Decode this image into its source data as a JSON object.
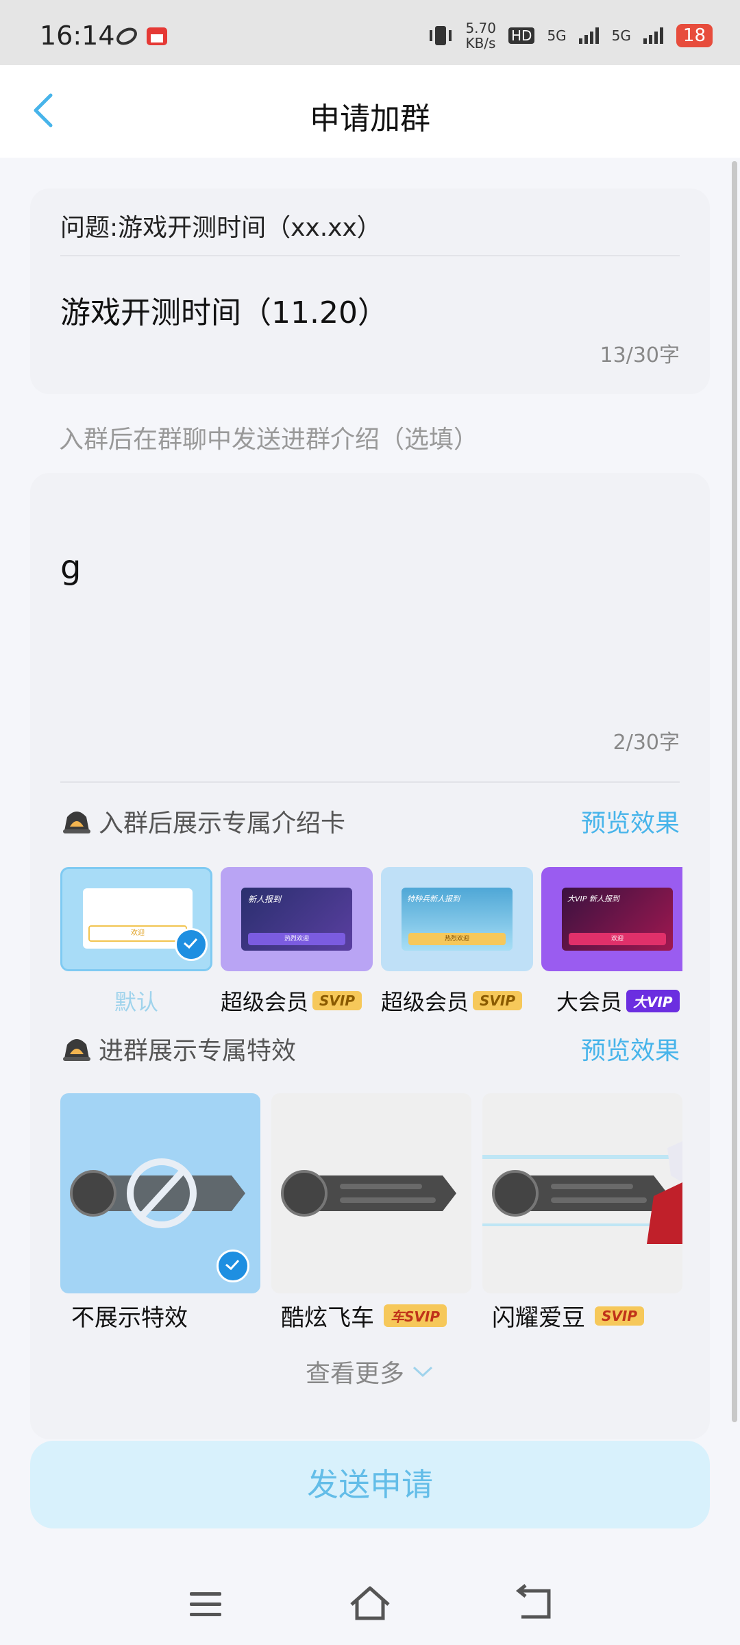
{
  "status_bar": {
    "time": "16:14",
    "net_speed_value": "5.70",
    "net_speed_unit": "KB/s",
    "hd": "HD",
    "sim1": "5G",
    "sim2": "5G",
    "battery": "18"
  },
  "header": {
    "title": "申请加群"
  },
  "question": {
    "prompt": "问题:游戏开测时间（xx.xx）",
    "answer": "游戏开测时间（11.20）",
    "count": "13/30字"
  },
  "intro": {
    "label": "入群后在群聊中发送进群介绍（选填）",
    "value": "g",
    "count": "2/30字"
  },
  "intro_card_section": {
    "title": "入群后展示专属介绍卡",
    "preview": "预览效果",
    "cards": [
      {
        "label": "默认",
        "tag": "",
        "selected": true
      },
      {
        "label": "超级会员",
        "tag": "SVIP",
        "selected": false
      },
      {
        "label": "超级会员",
        "tag": "SVIP",
        "selected": false
      },
      {
        "label": "大会员",
        "tag": "大VIP",
        "selected": false
      }
    ],
    "card_texts": {
      "c1_button": "欢迎",
      "c2_title": "新人报到",
      "c2_button": "热烈欢迎",
      "c3_title": "特种兵新人报到",
      "c3_button": "热烈欢迎",
      "c4_title": "大VIP 新人报到",
      "c4_button": "欢迎"
    }
  },
  "effect_section": {
    "title": "进群展示专属特效",
    "preview": "预览效果",
    "effects": [
      {
        "label": "不展示特效",
        "tag": "",
        "selected": true
      },
      {
        "label": "酷炫飞车",
        "tag": "车SVIP",
        "selected": false
      },
      {
        "label": "闪耀爱豆",
        "tag": "SVIP",
        "selected": false
      }
    ],
    "more": "查看更多"
  },
  "send_button": "发送申请",
  "colors": {
    "accent": "#47b4ea",
    "send_bg": "#d8f1fc",
    "check": "#1e8fe1"
  }
}
